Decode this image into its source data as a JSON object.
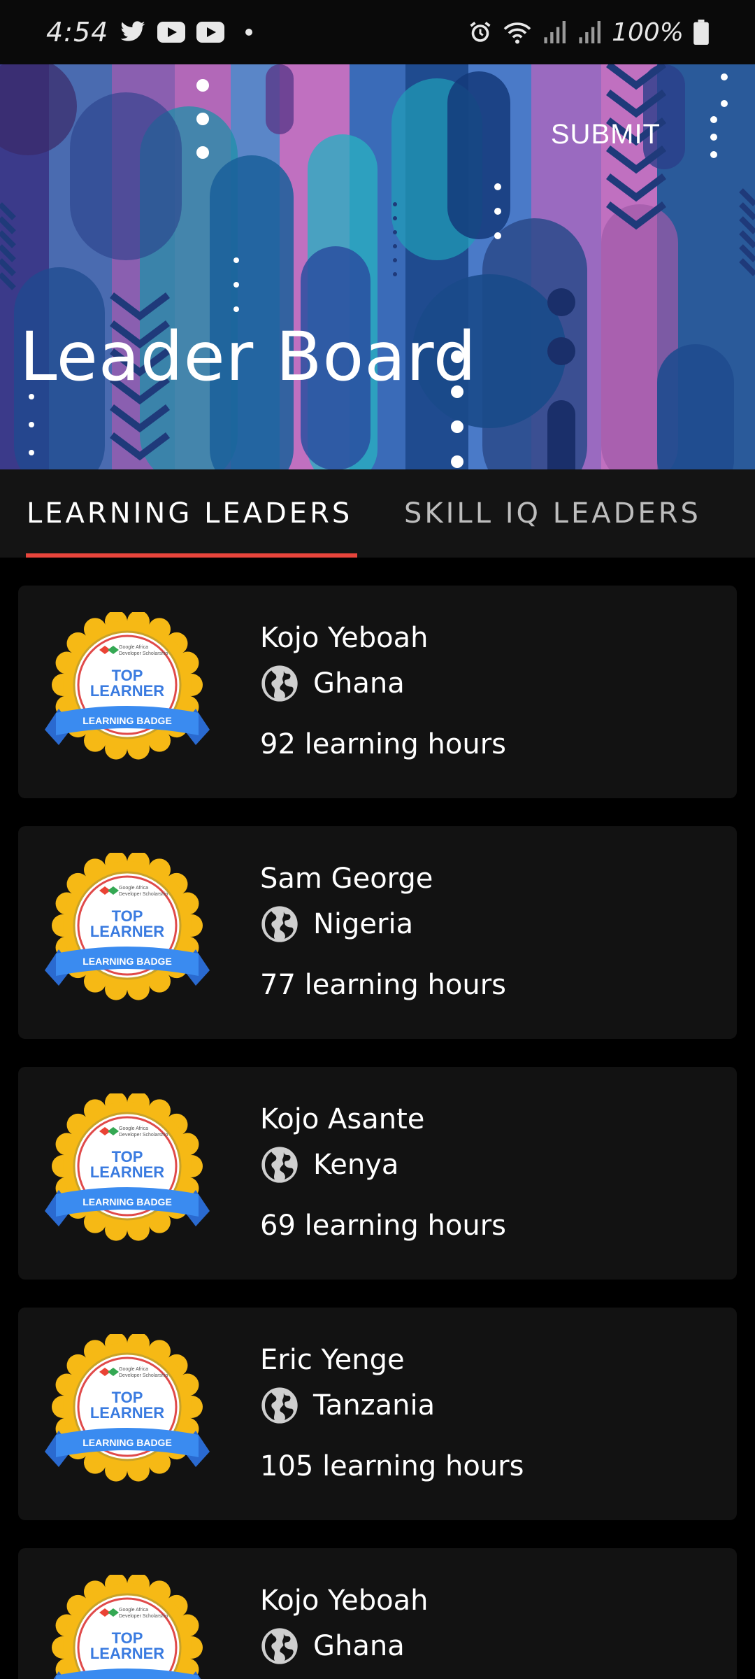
{
  "status_bar": {
    "time": "4:54",
    "battery": "100%"
  },
  "header": {
    "title": "Leader Board",
    "submit_label": "SUBMIT"
  },
  "tabs": [
    {
      "label": "LEARNING LEADERS",
      "selected": true
    },
    {
      "label": "SKILL IQ LEADERS",
      "selected": false
    }
  ],
  "accent_color": "#e8453c",
  "badge": {
    "line1": "TOP",
    "line2": "LEARNER",
    "ribbon": "LEARNING BADGE",
    "org": "Google Africa",
    "org2": "Developer Scholarship"
  },
  "leaders": [
    {
      "name": "Kojo Yeboah",
      "country": "Ghana",
      "hours": "92 learning hours"
    },
    {
      "name": "Sam George",
      "country": "Nigeria",
      "hours": "77 learning hours"
    },
    {
      "name": "Kojo Asante",
      "country": "Kenya",
      "hours": "69 learning hours"
    },
    {
      "name": "Eric Yenge",
      "country": "Tanzania",
      "hours": "105 learning hours"
    },
    {
      "name": "Kojo Yeboah",
      "country": "Ghana",
      "hours": ""
    }
  ]
}
